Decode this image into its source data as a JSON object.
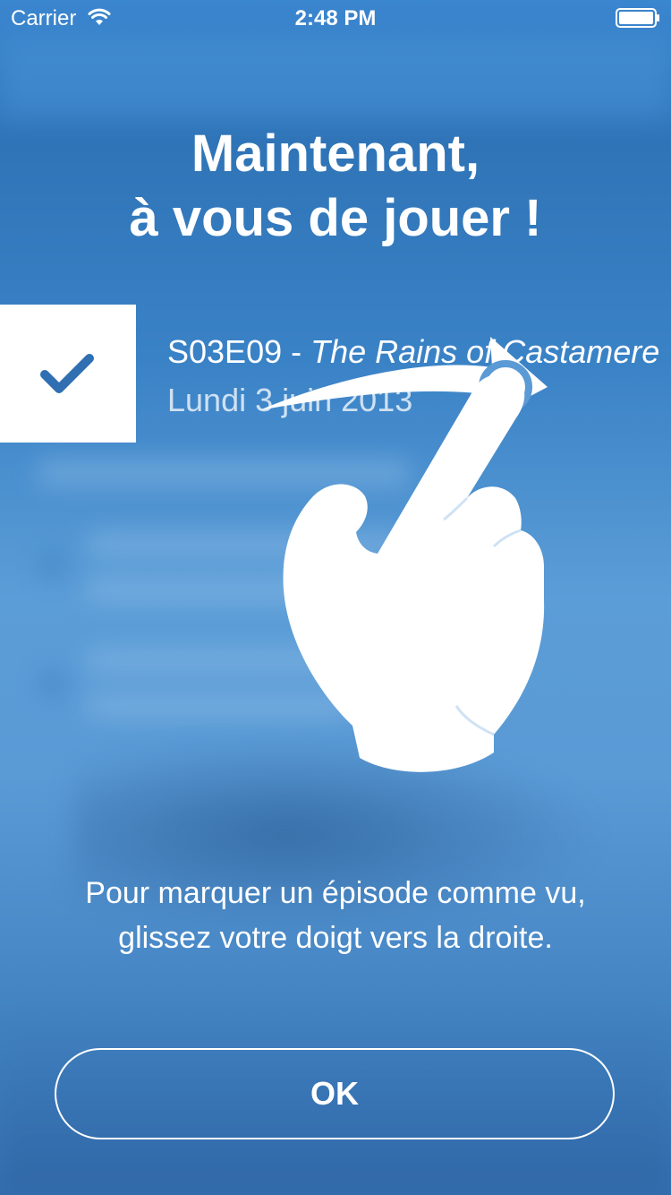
{
  "status_bar": {
    "carrier": "Carrier",
    "time": "2:48 PM",
    "wifi_icon": "wifi-icon",
    "battery_icon": "battery-icon"
  },
  "onboarding": {
    "title_line1": "Maintenant,",
    "title_line2": "à vous de jouer !",
    "episode": {
      "code": "S03E09 - ",
      "name": "The Rains of Castamere",
      "date": "Lundi 3 juin 2013",
      "checked": true,
      "check_icon": "checkmark-icon"
    },
    "gesture_icon": "swipe-right-hand-icon",
    "instruction_line1": "Pour marquer un épisode comme vu,",
    "instruction_line2": "glissez votre doigt vers la droite.",
    "ok_label": "OK"
  },
  "colors": {
    "background_top": "#3a86cf",
    "background_mid": "#5b9dd7",
    "accent": "#2f6fb2",
    "foreground": "#ffffff"
  }
}
